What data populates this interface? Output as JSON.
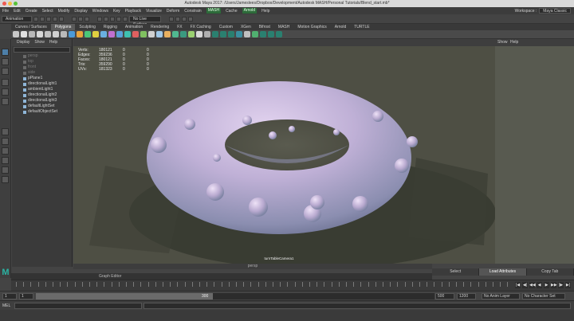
{
  "window": {
    "title": "Autodesk Maya 2017: /Users/Jameslees/Dropbox/Development/Autodesk MASH/Personal Tutorials/Blend_start.mb*"
  },
  "menubar": {
    "items": [
      "File",
      "Edit",
      "Create",
      "Select",
      "Modify",
      "Display",
      "Windows",
      "Key",
      "Playback",
      "Visualize",
      "Deform",
      "Constrain",
      "MASH",
      "Cache",
      "Arnold",
      "Help"
    ],
    "workspace_label": "Workspace :",
    "workspace_value": "Maya Classic"
  },
  "statusline": {
    "mode": "Animation",
    "live_surface": "No Live Surface"
  },
  "shelf": {
    "tabs": [
      "Curves / Surfaces",
      "Polygons",
      "Sculpting",
      "Rigging",
      "Animation",
      "Rendering",
      "FX",
      "FX Caching",
      "Custom",
      "XGen",
      "Bifrost",
      "MASH",
      "Motion Graphics",
      "Arnold",
      "TURTLE"
    ],
    "active_tab": "Polygons",
    "icon_colors": [
      "#c9c9c9",
      "#e0e0e0",
      "#b8b8b8",
      "#d8d8d8",
      "#c2c2c2",
      "#d0d0d0",
      "#bababa",
      "#4a9ad8",
      "#e8a43a",
      "#4ac878",
      "#e0d040",
      "#6ab0e0",
      "#c070d0",
      "#5aa0d8",
      "#3ec0b0",
      "#e06060",
      "#80c060",
      "#d0d0d0",
      "#a0c8e8",
      "#e8b060",
      "#50b890",
      "#3a9a80",
      "#9ad070",
      "#d8d8d8",
      "#b0b0b0",
      "#2a8070",
      "#2a8070",
      "#2a8070",
      "#3a8fa0",
      "#c0c0c0",
      "#50b070",
      "#2a8070",
      "#2a8070",
      "#2a8070"
    ]
  },
  "outliner": {
    "menu": [
      "Display",
      "Show",
      "Help"
    ],
    "items": [
      {
        "label": "persp",
        "dim": true
      },
      {
        "label": "top",
        "dim": true
      },
      {
        "label": "front",
        "dim": true
      },
      {
        "label": "side",
        "dim": true
      },
      {
        "label": "pPlane1",
        "dim": false
      },
      {
        "label": "directionalLight1",
        "dim": false
      },
      {
        "label": "ambientLight1",
        "dim": false
      },
      {
        "label": "directionalLight2",
        "dim": false
      },
      {
        "label": "directionalLight3",
        "dim": false
      },
      {
        "label": "defaultLightSet",
        "dim": false
      },
      {
        "label": "defaultObjectSet",
        "dim": false
      }
    ]
  },
  "viewport": {
    "menu": [
      "Show",
      "Help"
    ],
    "camera": "turnTableCamera1",
    "persp_label": "persp",
    "hud": [
      {
        "label": "Verts:",
        "a": "180121",
        "b": "0",
        "c": "0"
      },
      {
        "label": "Edges:",
        "a": "359236",
        "b": "0",
        "c": "0"
      },
      {
        "label": "Faces:",
        "a": "180121",
        "b": "0",
        "c": "0"
      },
      {
        "label": "Tris:",
        "a": "359290",
        "b": "0",
        "c": "0"
      },
      {
        "label": "UVs:",
        "a": "181323",
        "b": "0",
        "c": "0"
      }
    ]
  },
  "attribute_tabs": [
    "Select",
    "Load Attributes",
    "Copy Tab"
  ],
  "graph_editor_label": "Graph Editor",
  "mash_logo": "M",
  "playback_buttons": [
    "|◀",
    "◀|",
    "◀◀",
    "◀",
    "▶",
    "▶▶",
    "|▶",
    "▶|"
  ],
  "range": {
    "start": "1",
    "current": "1",
    "range_start": "1",
    "range_end": "300",
    "end": "500",
    "max": "1200",
    "anim_layer": "No Anim Layer",
    "character_set": "No Character Set"
  },
  "mel": {
    "label": "MEL"
  },
  "colors": {
    "torus_light": "#d8c9e6",
    "torus_mid": "#b7a9cd",
    "torus_shadow": "#6f7494",
    "ground": "#4e4f44"
  }
}
